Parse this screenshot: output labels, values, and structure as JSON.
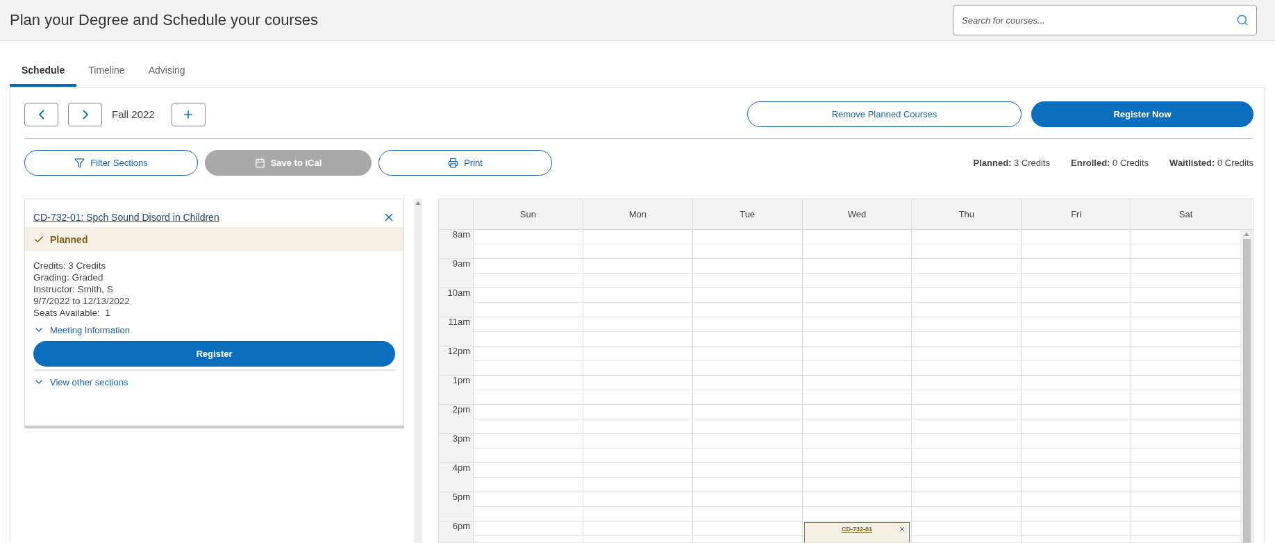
{
  "header": {
    "title": "Plan your Degree and Schedule your courses",
    "search": {
      "placeholder": "Search for courses..."
    }
  },
  "tabs": [
    {
      "label": "Schedule",
      "selected": true
    },
    {
      "label": "Timeline",
      "selected": false
    },
    {
      "label": "Advising",
      "selected": false
    }
  ],
  "term": {
    "label": "Fall 2022"
  },
  "actions": [
    {
      "label": "Remove Planned Courses",
      "kind": "outline"
    },
    {
      "label": "Register Now",
      "kind": "primary"
    }
  ],
  "tools": [
    {
      "label": "Filter Sections",
      "kind": "filter",
      "disabled": false
    },
    {
      "label": "Save to iCal",
      "kind": "calendar",
      "disabled": true
    },
    {
      "label": "Print",
      "kind": "print",
      "disabled": false
    }
  ],
  "credits": [
    {
      "label": "Planned:",
      "value": "3 Credits"
    },
    {
      "label": "Enrolled:",
      "value": "0 Credits"
    },
    {
      "label": "Waitlisted:",
      "value": "0 Credits"
    }
  ],
  "section": {
    "title": "CD-732-01: Spch Sound Disord in Children",
    "status": "Planned",
    "details": [
      "Credits: 3 Credits",
      "Grading: Graded",
      "Instructor: Smith, S",
      "9/7/2022 to 12/13/2022",
      "Seats Available:  1"
    ],
    "meeting_link": "Meeting Information",
    "register": "Register",
    "other_link": "View other sections"
  },
  "calendar": {
    "days": [
      "Sun",
      "Mon",
      "Tue",
      "Wed",
      "Thu",
      "Fri",
      "Sat"
    ],
    "rows": [
      {
        "time": "8am"
      },
      {
        "time": "9am"
      },
      {
        "time": "10am"
      },
      {
        "time": "11am"
      },
      {
        "time": "12pm"
      },
      {
        "time": "1pm"
      },
      {
        "time": "2pm"
      },
      {
        "time": "3pm"
      },
      {
        "time": "4pm"
      },
      {
        "time": "5pm"
      },
      {
        "time": "6pm",
        "slots": [
          {
            "kind": "empty"
          },
          {
            "kind": "empty"
          },
          {
            "kind": "empty"
          },
          {
            "kind": "event",
            "label": "CD-732-01"
          },
          {
            "kind": "empty"
          },
          {
            "kind": "empty"
          },
          {
            "kind": "empty"
          }
        ]
      }
    ]
  }
}
